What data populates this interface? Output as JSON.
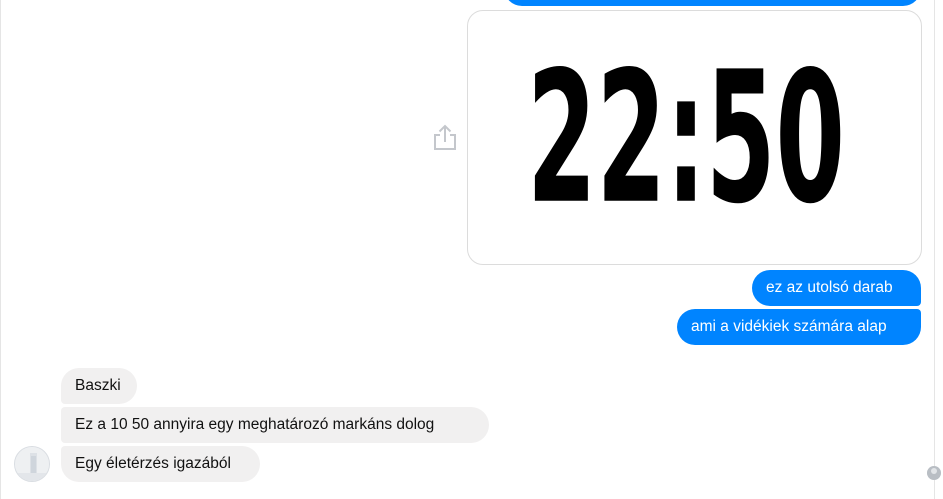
{
  "conversation": {
    "image_message": {
      "clock_text": "22:50"
    },
    "messages": [
      {
        "direction": "outgoing",
        "text": "ez az utolsó darab"
      },
      {
        "direction": "outgoing",
        "text": "ami a vidékiek számára alap"
      },
      {
        "direction": "incoming",
        "text": "Baszki"
      },
      {
        "direction": "incoming",
        "text": "Ez a 10 50 annyira egy meghatározó markáns dolog"
      },
      {
        "direction": "incoming",
        "text": "Egy életérzés igazából"
      }
    ],
    "icons": {
      "share": "share-icon",
      "avatar": "contact-avatar",
      "seen": "seen-avatar"
    }
  },
  "colors": {
    "outgoing_bubble": "#0084ff",
    "incoming_bubble": "#f1f0f0"
  }
}
